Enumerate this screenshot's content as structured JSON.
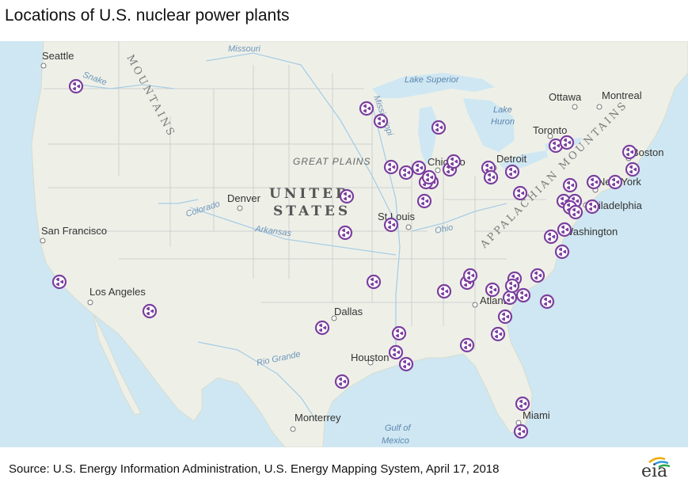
{
  "title": "Locations of U.S. nuclear power plants",
  "source": "Source: U.S. Energy Information Administration, U.S. Energy Mapping System, April 17, 2018",
  "logo_text": "eia",
  "colors": {
    "plant_marker": "#7b3f9e",
    "water": "#cfe7f2",
    "land": "#eef0e8"
  },
  "map": {
    "country_label": [
      "UNITED",
      "STATES"
    ],
    "region_labels": {
      "great_plains": "GREAT PLAINS",
      "appalachian": "APPALACHIAN MOUNTAINS",
      "rocky": "MOUNTAINS"
    },
    "water_labels": {
      "lake_superior": "Lake Superior",
      "lake_huron": [
        "Lake",
        "Huron"
      ],
      "gulf_of_mexico": [
        "Gulf of",
        "Mexico"
      ]
    },
    "river_labels": {
      "missouri": "Missouri",
      "snake": "Snake",
      "mississippi": "Mississippi",
      "colorado": "Colorado",
      "arkansas": "Arkansas",
      "ohio": "Ohio",
      "rio_grande": "Rio Grande"
    },
    "cities": [
      {
        "name": "Seattle"
      },
      {
        "name": "San Francisco"
      },
      {
        "name": "Los Angeles"
      },
      {
        "name": "Denver"
      },
      {
        "name": "Dallas"
      },
      {
        "name": "Houston"
      },
      {
        "name": "Monterrey"
      },
      {
        "name": "St Louis"
      },
      {
        "name": "Chicago"
      },
      {
        "name": "Detroit"
      },
      {
        "name": "Toronto"
      },
      {
        "name": "Ottawa"
      },
      {
        "name": "Montreal"
      },
      {
        "name": "Boston"
      },
      {
        "name": "New York"
      },
      {
        "name": "Philadelphia"
      },
      {
        "name": "Washington"
      },
      {
        "name": "Atlanta"
      },
      {
        "name": "Miami"
      }
    ],
    "plant_count": 62
  }
}
